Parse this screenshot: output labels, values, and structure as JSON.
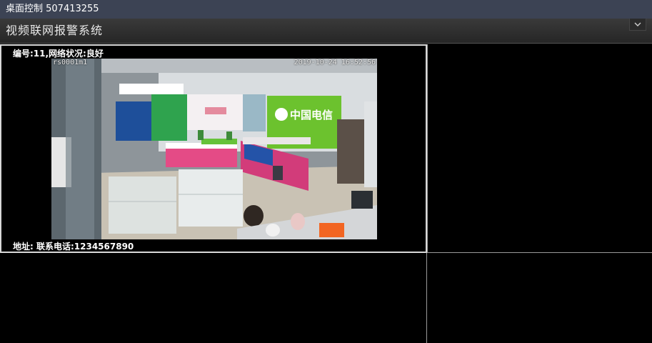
{
  "window": {
    "title": "桌面控制 507413255"
  },
  "app": {
    "header_title": "视频联网报警系统"
  },
  "channel1": {
    "status_text": "编号:11,网络状况:良好",
    "contact_text": "地址:  联系电话:1234567890",
    "camera_timestamp": "2019-10-24 16:52:56",
    "camera_id": "rs0001m1",
    "store_sign": "中国电信"
  }
}
